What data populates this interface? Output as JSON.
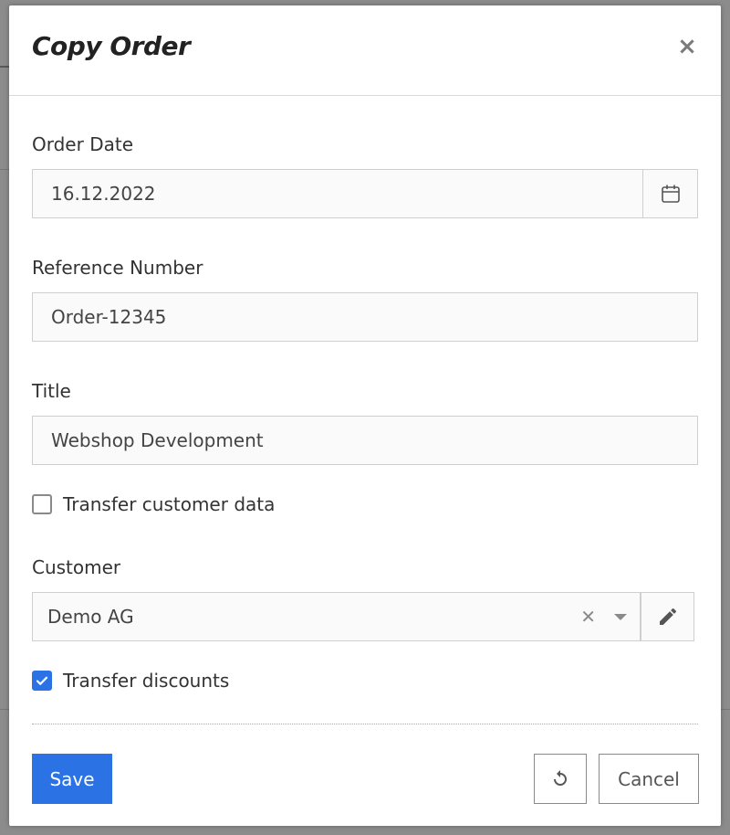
{
  "dialog": {
    "title": "Copy Order",
    "close_icon": "close-icon"
  },
  "form": {
    "order_date_label": "Order Date",
    "order_date_value": "16.12.2022",
    "reference_label": "Reference Number",
    "reference_value": "Order-12345",
    "title_label": "Title",
    "title_value": "Webshop Development",
    "transfer_customer_label": "Transfer customer data",
    "transfer_customer_checked": false,
    "customer_label": "Customer",
    "customer_value": "Demo AG",
    "transfer_discounts_label": "Transfer discounts",
    "transfer_discounts_checked": true
  },
  "footer": {
    "save_label": "Save",
    "cancel_label": "Cancel"
  },
  "colors": {
    "primary": "#2b73e5",
    "overlay": "#8c8c8c"
  }
}
